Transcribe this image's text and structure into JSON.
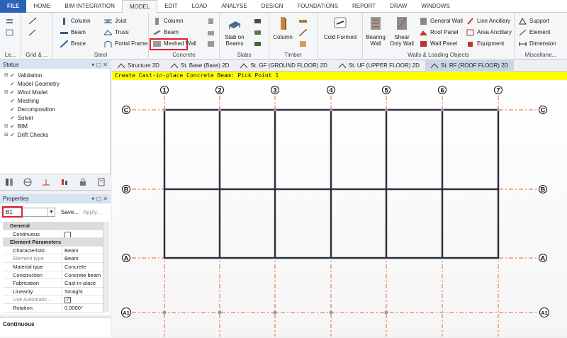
{
  "tabs": [
    "FILE",
    "HOME",
    "BIM INTEGRATION",
    "MODEL",
    "EDIT",
    "LOAD",
    "ANALYSE",
    "DESIGN",
    "FOUNDATIONS",
    "REPORT",
    "DRAW",
    "WINDOWS"
  ],
  "active_tab": "MODEL",
  "ribbon": {
    "groups": {
      "level": "Le...",
      "grid": "Grid & ...",
      "steel": "Steel",
      "concrete": "Concrete",
      "slabs": "Slabs",
      "timber": "Timber",
      "walls": "Walls & Loading Objects",
      "misc": "Miscellane..."
    },
    "steel": {
      "column": "Column",
      "beam": "Beam",
      "brace": "Brace",
      "joist": "Joist",
      "truss": "Truss",
      "portal": "Portal Frame"
    },
    "concrete": {
      "column": "Column",
      "beam": "Beam",
      "meshed_wall": "Meshed Wall"
    },
    "slabs": {
      "slab_on_beams": "Slab on Beams"
    },
    "timber": {
      "column": "Column"
    },
    "cold_formed": "Cold Formed",
    "walls": {
      "bearing_wall": "Bearing Wall",
      "shear_only_wall": "Shear Only Wall",
      "general_wall": "General Wall",
      "roof_panel": "Roof Panel",
      "wall_panel": "Wall Panel",
      "line_ancillary": "Line Ancillary",
      "area_ancillary": "Area Ancillary",
      "equipment": "Equipment"
    },
    "misc": {
      "support": "Support",
      "element": "Element",
      "dimension": "Dimension"
    }
  },
  "status_panel": {
    "title": "Status",
    "items": [
      "Validation",
      "Model Geometry",
      "Wind Model",
      "Meshing",
      "Decomposition",
      "Solver",
      "BIM",
      "Drift Checks"
    ]
  },
  "properties_panel": {
    "title": "Properties",
    "selected": "B1",
    "save": "Save...",
    "apply": "Apply...",
    "rows": [
      {
        "section": "General"
      },
      {
        "key": "Continuous",
        "value": ""
      },
      {
        "section": "Element Parameters"
      },
      {
        "key": "Characteristic",
        "value": "Beam"
      },
      {
        "key": "Element type",
        "value": "Beam"
      },
      {
        "key": "Material type",
        "value": "Concrete"
      },
      {
        "key": "Construction",
        "value": "Concrete beam"
      },
      {
        "key": "Fabrication",
        "value": "Cast-in-place"
      },
      {
        "key": "Linearity",
        "value": "Straight"
      },
      {
        "key": "Use Automatic ...",
        "value": ""
      },
      {
        "key": "Rotation",
        "value": "0.0000°"
      }
    ],
    "description": "Continuous"
  },
  "doc_tabs": [
    "Structure 3D",
    "St. Base (Base) 2D",
    "St. GF (GROUND FLOOR) 2D",
    "St. UF (UPPER FLOOR) 2D",
    "St. RF (ROOF FLOOR) 2D"
  ],
  "active_doc_tab": "St. RF (ROOF FLOOR) 2D",
  "command_prompt": "Create Cast-in-place Concrete Beam: Pick Point 1",
  "grid": {
    "columns": [
      "1",
      "2",
      "3",
      "4",
      "5",
      "6",
      "7"
    ],
    "rows": [
      "C",
      "B",
      "A",
      "A1"
    ]
  },
  "colors": {
    "file_tab": "#2a62b8",
    "grid_line": "#e8632a",
    "beam": "#2b3140",
    "prompt_bg": "#ffff00",
    "highlight": "#e0202a"
  }
}
